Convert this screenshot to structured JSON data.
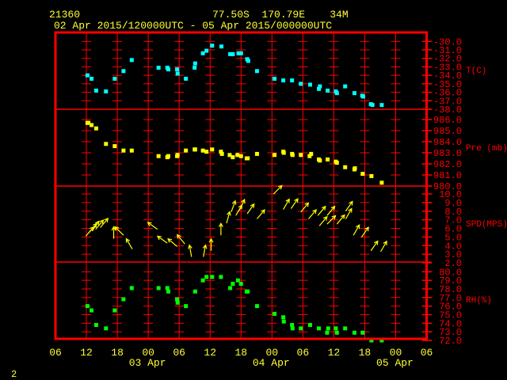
{
  "header": {
    "station_id": "21360",
    "location": "77.50S  170.79E    34M",
    "time_range": "02 Apr 2015/120000UTC - 05 Apr 2015/000000UTC"
  },
  "footer": {
    "page_number": "2"
  },
  "colors": {
    "frame": "#ff0000",
    "text": "#ffff33",
    "temp": "#00ffff",
    "pres": "#ffff00",
    "wind": "#ffff00",
    "rh": "#00ff00",
    "background": "#000000"
  },
  "chart_data": [
    {
      "type": "scatter",
      "name": "temperature",
      "ylabel": "T(C)",
      "ylim": [
        -38,
        -30
      ],
      "yticks": [
        "-30.0",
        "-31.0",
        "-32.0",
        "-33.0",
        "-34.0",
        "-35.0",
        "-36.0",
        "-37.0",
        "-38.0"
      ],
      "x_units": "hours since 02 Apr 00UTC",
      "points": [
        [
          12.2,
          -34.0
        ],
        [
          13.0,
          -34.4
        ],
        [
          13.9,
          -35.8
        ],
        [
          15.8,
          -35.9
        ],
        [
          17.5,
          -34.4
        ],
        [
          19.2,
          -33.5
        ],
        [
          20.8,
          -32.2
        ],
        [
          26.0,
          -33.1
        ],
        [
          27.7,
          -33.1
        ],
        [
          27.9,
          -33.3
        ],
        [
          29.6,
          -33.3
        ],
        [
          29.7,
          -33.8
        ],
        [
          31.3,
          -34.4
        ],
        [
          33.0,
          -33.1
        ],
        [
          33.1,
          -32.6
        ],
        [
          34.6,
          -31.4
        ],
        [
          35.3,
          -31.1
        ],
        [
          36.4,
          -30.5
        ],
        [
          38.2,
          -30.6
        ],
        [
          39.9,
          -31.5
        ],
        [
          40.4,
          -31.5
        ],
        [
          41.5,
          -31.4
        ],
        [
          42.0,
          -31.4
        ],
        [
          43.2,
          -32.1
        ],
        [
          43.4,
          -32.3
        ],
        [
          45.1,
          -33.5
        ],
        [
          48.5,
          -34.4
        ],
        [
          50.2,
          -34.6
        ],
        [
          51.9,
          -34.6
        ],
        [
          53.6,
          -35.0
        ],
        [
          55.4,
          -35.1
        ],
        [
          57.1,
          -35.6
        ],
        [
          57.3,
          -35.3
        ],
        [
          58.8,
          -35.8
        ],
        [
          60.4,
          -35.9
        ],
        [
          60.6,
          -36.1
        ],
        [
          62.2,
          -35.3
        ],
        [
          64.0,
          -36.1
        ],
        [
          65.5,
          -36.4
        ],
        [
          65.7,
          -36.5
        ],
        [
          67.2,
          -37.4
        ],
        [
          67.5,
          -37.5
        ],
        [
          69.3,
          -37.5
        ]
      ]
    },
    {
      "type": "scatter",
      "name": "pressure",
      "ylabel": "Pre (mb)",
      "ylim": [
        980,
        986
      ],
      "yticks": [
        "986.0",
        "985.0",
        "984.0",
        "983.0",
        "982.0",
        "981.0",
        "980.0"
      ],
      "points": [
        [
          12.2,
          985.7
        ],
        [
          12.4,
          985.7
        ],
        [
          13.0,
          985.5
        ],
        [
          13.9,
          985.2
        ],
        [
          15.8,
          983.8
        ],
        [
          17.5,
          983.6
        ],
        [
          19.2,
          983.2
        ],
        [
          20.8,
          983.2
        ],
        [
          26.0,
          982.7
        ],
        [
          27.7,
          982.6
        ],
        [
          27.9,
          982.7
        ],
        [
          29.6,
          982.7
        ],
        [
          29.7,
          982.8
        ],
        [
          31.3,
          983.2
        ],
        [
          33.0,
          983.3
        ],
        [
          33.1,
          983.3
        ],
        [
          34.6,
          983.2
        ],
        [
          35.3,
          983.1
        ],
        [
          36.4,
          983.3
        ],
        [
          38.1,
          983.1
        ],
        [
          38.3,
          982.9
        ],
        [
          39.8,
          982.8
        ],
        [
          40.4,
          982.6
        ],
        [
          41.3,
          982.8
        ],
        [
          42.0,
          982.7
        ],
        [
          43.1,
          982.5
        ],
        [
          43.3,
          982.5
        ],
        [
          45.1,
          982.9
        ],
        [
          48.5,
          982.8
        ],
        [
          50.2,
          983.1
        ],
        [
          50.3,
          983.0
        ],
        [
          51.9,
          982.9
        ],
        [
          52.0,
          982.8
        ],
        [
          53.6,
          982.8
        ],
        [
          55.3,
          982.7
        ],
        [
          55.6,
          982.9
        ],
        [
          57.1,
          982.4
        ],
        [
          57.3,
          982.3
        ],
        [
          58.8,
          982.4
        ],
        [
          60.4,
          982.2
        ],
        [
          60.6,
          982.1
        ],
        [
          62.2,
          981.7
        ],
        [
          64.0,
          981.5
        ],
        [
          64.1,
          981.6
        ],
        [
          65.6,
          981.1
        ],
        [
          67.3,
          980.9
        ],
        [
          69.3,
          980.3
        ]
      ]
    },
    {
      "type": "vector",
      "name": "wind",
      "ylabel": "SPD(MPS)",
      "ylim": [
        2,
        10
      ],
      "yticks": [
        "10.0",
        "9.0",
        "8.0",
        "7.0",
        "6.0",
        "5.0",
        "4.0",
        "3.0",
        "2.0"
      ],
      "points_t_speed_dir": [
        [
          11.9,
          5.1,
          40
        ],
        [
          12.5,
          5.5,
          40
        ],
        [
          13.1,
          5.7,
          35
        ],
        [
          13.8,
          5.9,
          40
        ],
        [
          14.7,
          6.1,
          40
        ],
        [
          17.3,
          4.8,
          0
        ],
        [
          19.2,
          5.2,
          315
        ],
        [
          20.9,
          3.6,
          330
        ],
        [
          25.8,
          5.9,
          305
        ],
        [
          27.7,
          4.3,
          305
        ],
        [
          29.6,
          3.9,
          310
        ],
        [
          31.1,
          4.2,
          320
        ],
        [
          32.4,
          2.7,
          350
        ],
        [
          34.7,
          2.7,
          10
        ],
        [
          36.2,
          3.4,
          0
        ],
        [
          38.1,
          5.2,
          0
        ],
        [
          39.2,
          6.6,
          15
        ],
        [
          40.1,
          7.9,
          20
        ],
        [
          41.0,
          7.5,
          30
        ],
        [
          41.7,
          8.1,
          25
        ],
        [
          43.2,
          7.7,
          35
        ],
        [
          45.1,
          7.1,
          40
        ],
        [
          48.3,
          10.0,
          45
        ],
        [
          50.2,
          8.2,
          30
        ],
        [
          51.7,
          8.3,
          35
        ],
        [
          53.6,
          7.9,
          40
        ],
        [
          55.1,
          7.1,
          40
        ],
        [
          56.9,
          7.5,
          40
        ],
        [
          57.2,
          6.3,
          40
        ],
        [
          58.7,
          7.5,
          40
        ],
        [
          58.7,
          6.5,
          45
        ],
        [
          60.6,
          6.5,
          40
        ],
        [
          62.3,
          8.0,
          35
        ],
        [
          62.3,
          7.1,
          30
        ],
        [
          63.8,
          5.2,
          30
        ],
        [
          65.4,
          5.0,
          35
        ],
        [
          67.2,
          3.4,
          35
        ],
        [
          69.1,
          3.3,
          30
        ]
      ]
    },
    {
      "type": "scatter",
      "name": "relative_humidity",
      "ylabel": "RH(%)",
      "ylim": [
        72,
        80
      ],
      "yticks": [
        "80.0",
        "79.0",
        "78.0",
        "77.0",
        "76.0",
        "75.0",
        "74.0",
        "73.0",
        "72.0"
      ],
      "points": [
        [
          12.2,
          76.0
        ],
        [
          13.0,
          75.5
        ],
        [
          13.9,
          73.8
        ],
        [
          15.8,
          73.4
        ],
        [
          17.5,
          75.5
        ],
        [
          19.2,
          76.8
        ],
        [
          20.8,
          78.1
        ],
        [
          26.0,
          78.1
        ],
        [
          27.7,
          78.1
        ],
        [
          27.9,
          77.7
        ],
        [
          29.6,
          76.8
        ],
        [
          29.7,
          76.4
        ],
        [
          31.3,
          76.0
        ],
        [
          33.1,
          77.7
        ],
        [
          34.6,
          79.0
        ],
        [
          35.3,
          79.4
        ],
        [
          36.4,
          79.4
        ],
        [
          38.1,
          79.4
        ],
        [
          39.9,
          78.1
        ],
        [
          40.4,
          78.6
        ],
        [
          41.4,
          79.0
        ],
        [
          42.0,
          78.6
        ],
        [
          43.1,
          77.7
        ],
        [
          43.3,
          77.7
        ],
        [
          45.1,
          76.0
        ],
        [
          48.5,
          75.1
        ],
        [
          50.2,
          74.7
        ],
        [
          50.3,
          74.2
        ],
        [
          51.9,
          73.8
        ],
        [
          52.0,
          73.4
        ],
        [
          53.6,
          73.4
        ],
        [
          55.4,
          73.8
        ],
        [
          57.1,
          73.4
        ],
        [
          58.7,
          72.9
        ],
        [
          58.9,
          73.4
        ],
        [
          60.4,
          73.4
        ],
        [
          60.6,
          72.9
        ],
        [
          62.2,
          73.4
        ],
        [
          64.0,
          72.9
        ],
        [
          65.6,
          72.9
        ],
        [
          67.3,
          72.0
        ],
        [
          69.3,
          72.0
        ]
      ]
    }
  ],
  "x_axis": {
    "xlim_hours": [
      6,
      78
    ],
    "tick_hours": [
      6,
      12,
      18,
      24,
      30,
      36,
      42,
      48,
      54,
      60,
      66,
      72,
      78
    ],
    "tick_labels": [
      "06",
      "12",
      "18",
      "00",
      "06",
      "12",
      "18",
      "00",
      "06",
      "12",
      "18",
      "00",
      "06"
    ],
    "date_labels": [
      {
        "hour": 24,
        "text": "03 Apr"
      },
      {
        "hour": 48,
        "text": "04 Apr"
      },
      {
        "hour": 72,
        "text": "05 Apr"
      }
    ]
  }
}
